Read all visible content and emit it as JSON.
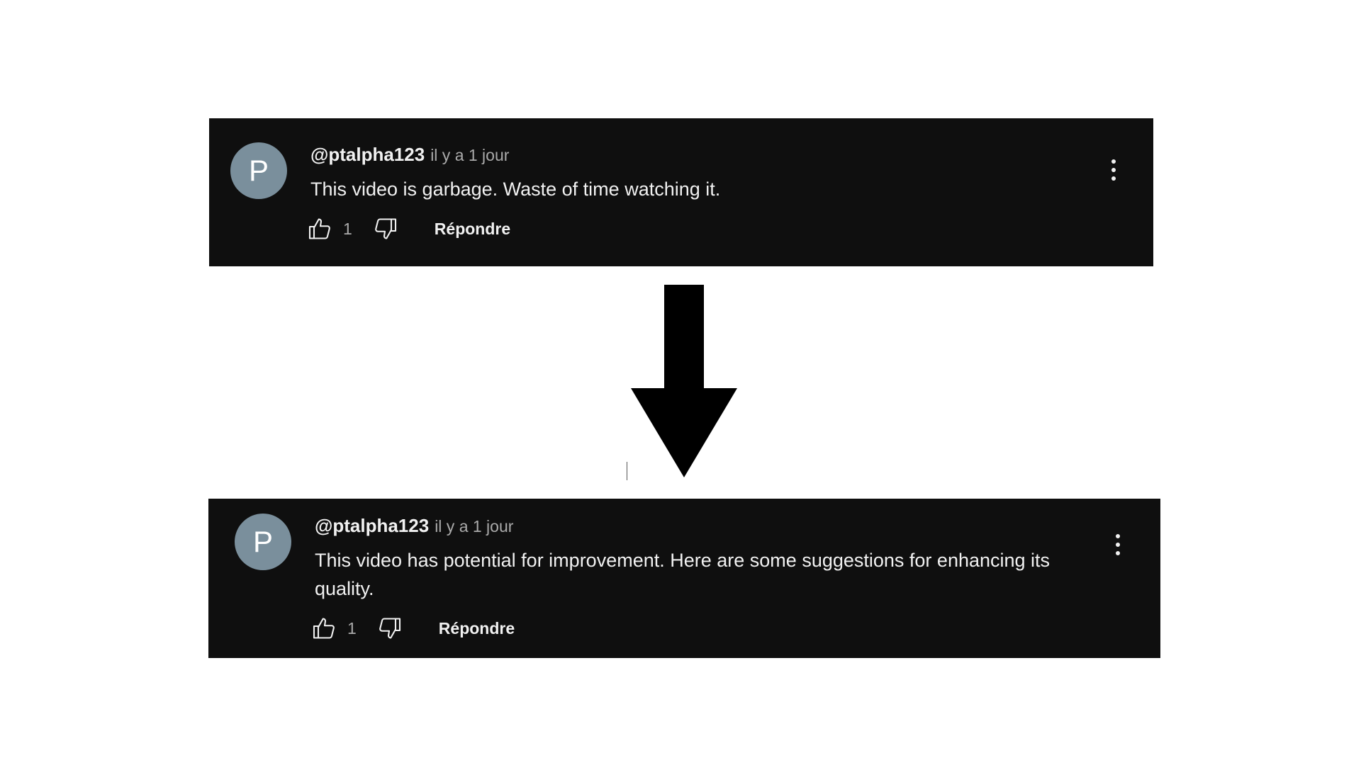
{
  "comments": [
    {
      "avatar_initial": "P",
      "handle": "@ptalpha123",
      "timestamp": "il y a 1 jour",
      "text": "This video is garbage. Waste of time watching it.",
      "like_count": "1",
      "reply_label": "Répondre"
    },
    {
      "avatar_initial": "P",
      "handle": "@ptalpha123",
      "timestamp": "il y a 1 jour",
      "text": "This video has potential for improvement. Here are some suggestions for enhancing its quality.",
      "like_count": "1",
      "reply_label": "Répondre"
    }
  ],
  "icons": {
    "like": "thumbs-up-icon",
    "dislike": "thumbs-down-icon",
    "more": "more-vertical-icon",
    "arrow": "arrow-down-icon"
  },
  "colors": {
    "card_background": "#0f0f0f",
    "avatar": "#7a8f9c",
    "primary_text": "#f1f1f1",
    "secondary_text": "#aaaaaa",
    "page_background": "#ffffff"
  }
}
